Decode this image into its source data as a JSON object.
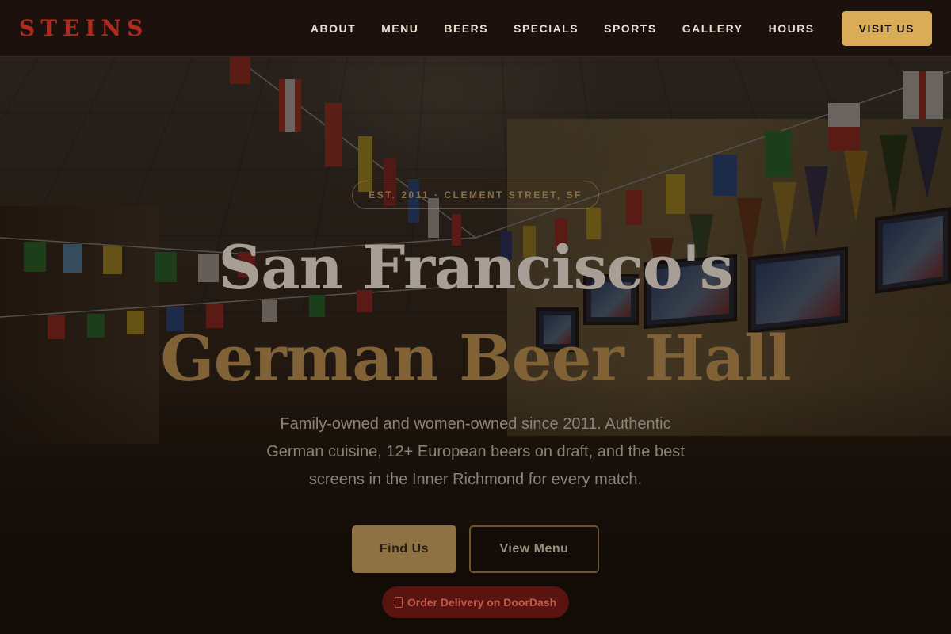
{
  "brand": {
    "logo": "STEINS"
  },
  "nav": {
    "links": [
      "ABOUT",
      "MENU",
      "BEERS",
      "SPECIALS",
      "SPORTS",
      "GALLERY",
      "HOURS"
    ],
    "cta": "VISIT US"
  },
  "hero": {
    "eyebrow": "EST. 2011 · CLEMENT STREET, SF",
    "title_line1": "San Francisco's",
    "title_line2": "German Beer Hall",
    "subtitle": "Family-owned and women-owned since 2011. Authentic German cuisine, 12+ European beers on draft, and the best screens in the Inner Richmond for every match.",
    "primary_button": "Find Us",
    "secondary_button": "View Menu",
    "delivery_button": "Order Delivery on DoorDash"
  },
  "colors": {
    "accent_gold": "#d9ad58",
    "logo_red": "#b02a1e",
    "nav_bg": "#1b120d"
  },
  "icons": {
    "delivery": "doordash-icon"
  }
}
